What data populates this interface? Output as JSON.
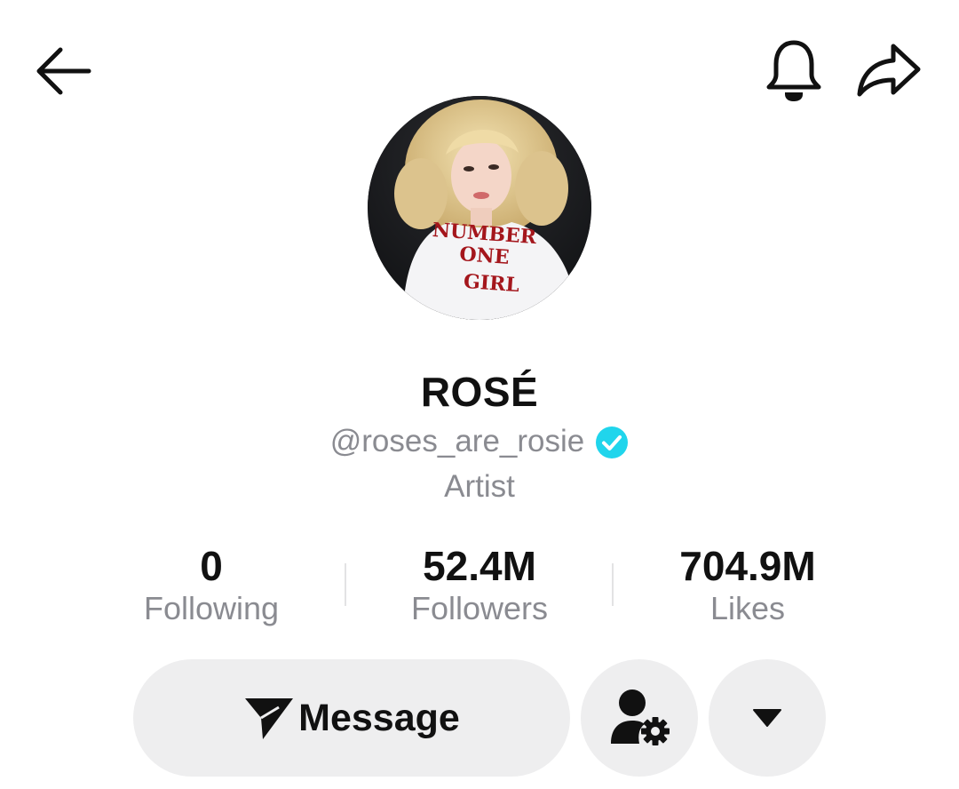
{
  "profile": {
    "display_name": "ROSÉ",
    "username": "@roses_are_rosie",
    "verified": true,
    "bio": "Artist",
    "avatar_shirt_lines": [
      "NUMBER",
      "ONE",
      "GIRL"
    ]
  },
  "stats": [
    {
      "value": "0",
      "label": "Following"
    },
    {
      "value": "52.4M",
      "label": "Followers"
    },
    {
      "value": "704.9M",
      "label": "Likes"
    }
  ],
  "actions": {
    "message_label": "Message"
  },
  "icons": {
    "back": "arrow-left-icon",
    "notifications": "bell-icon",
    "share": "share-arrow-icon",
    "verified": "verified-check-icon",
    "message": "send-paper-plane-icon",
    "manage": "user-settings-icon",
    "more": "caret-down-icon"
  },
  "colors": {
    "verified": "#20D5EC",
    "muted_text": "#8A8B91",
    "button_bg": "#EEEEEF",
    "shirt_text": "#A4161C"
  }
}
